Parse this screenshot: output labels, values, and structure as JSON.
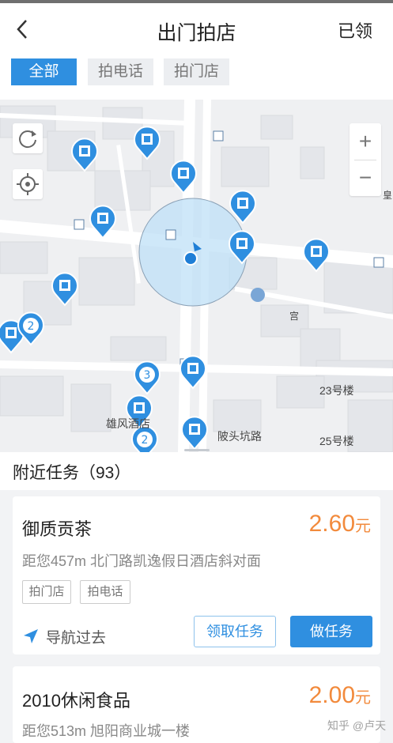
{
  "header": {
    "title": "出门拍店",
    "right_label": "已领",
    "back_icon": "chevron-left-icon"
  },
  "tabs": [
    {
      "label": "全部",
      "active": true
    },
    {
      "label": "拍电话",
      "active": false
    },
    {
      "label": "拍门店",
      "active": false
    }
  ],
  "map": {
    "labels": {
      "hotel": "雄风酒店",
      "road": "陂头坑路",
      "bldg23": "23号楼",
      "bldg25": "25号楼",
      "gong": "宫",
      "edge": "皇"
    },
    "cluster_counts": [
      "2",
      "3",
      "2"
    ],
    "controls": {
      "refresh_icon": "refresh-icon",
      "locate_icon": "locate-icon",
      "zoom_in": "+",
      "zoom_out": "−"
    },
    "accent_color": "#2f8fe0"
  },
  "nearby": {
    "title": "附近任务（93）"
  },
  "tasks": [
    {
      "name": "御质贡茶",
      "price": "2.60",
      "unit": "元",
      "desc": "距您457m  北门路凯逸假日酒店斜对面",
      "tags": [
        "拍门店",
        "拍电话"
      ],
      "nav_label": "导航过去",
      "claim_label": "领取任务",
      "do_label": "做任务"
    },
    {
      "name": "2010休闲食品",
      "price": "2.00",
      "unit": "元",
      "desc": "距您513m  旭阳商业城一楼"
    }
  ],
  "watermark": "知乎 @卢天"
}
